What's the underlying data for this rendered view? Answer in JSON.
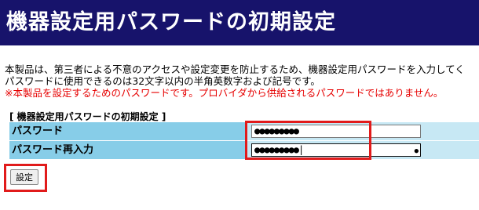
{
  "header": {
    "title": "機器設定用パスワードの初期設定"
  },
  "description": {
    "line1": "本製品は、第三者による不意のアクセスや設定変更を防止するため、機器設定用パスワードを入力してく",
    "line2": "パスワードに使用できるのは32文字以内の半角英数字および記号です。",
    "warning": "※本製品を設定するためのパスワードです。プロバイダから供給されるパスワードではありません。"
  },
  "form": {
    "section_title": "[ 機器設定用パスワードの初期設定 ]",
    "password_label": "パスワード",
    "password_value": "●●●●●●●●●",
    "password_confirm_label": "パスワード再入力",
    "password_confirm_value": "●●●●●●●●●|"
  },
  "buttons": {
    "submit_label": "設定"
  },
  "icons": {
    "reveal_password": "eye-icon"
  },
  "colors": {
    "header_bg": "#17136b",
    "label_bg": "#87cde8",
    "input_cell_bg": "#c7e8f4",
    "warning": "#e60000",
    "highlight": "#e11b1b"
  }
}
